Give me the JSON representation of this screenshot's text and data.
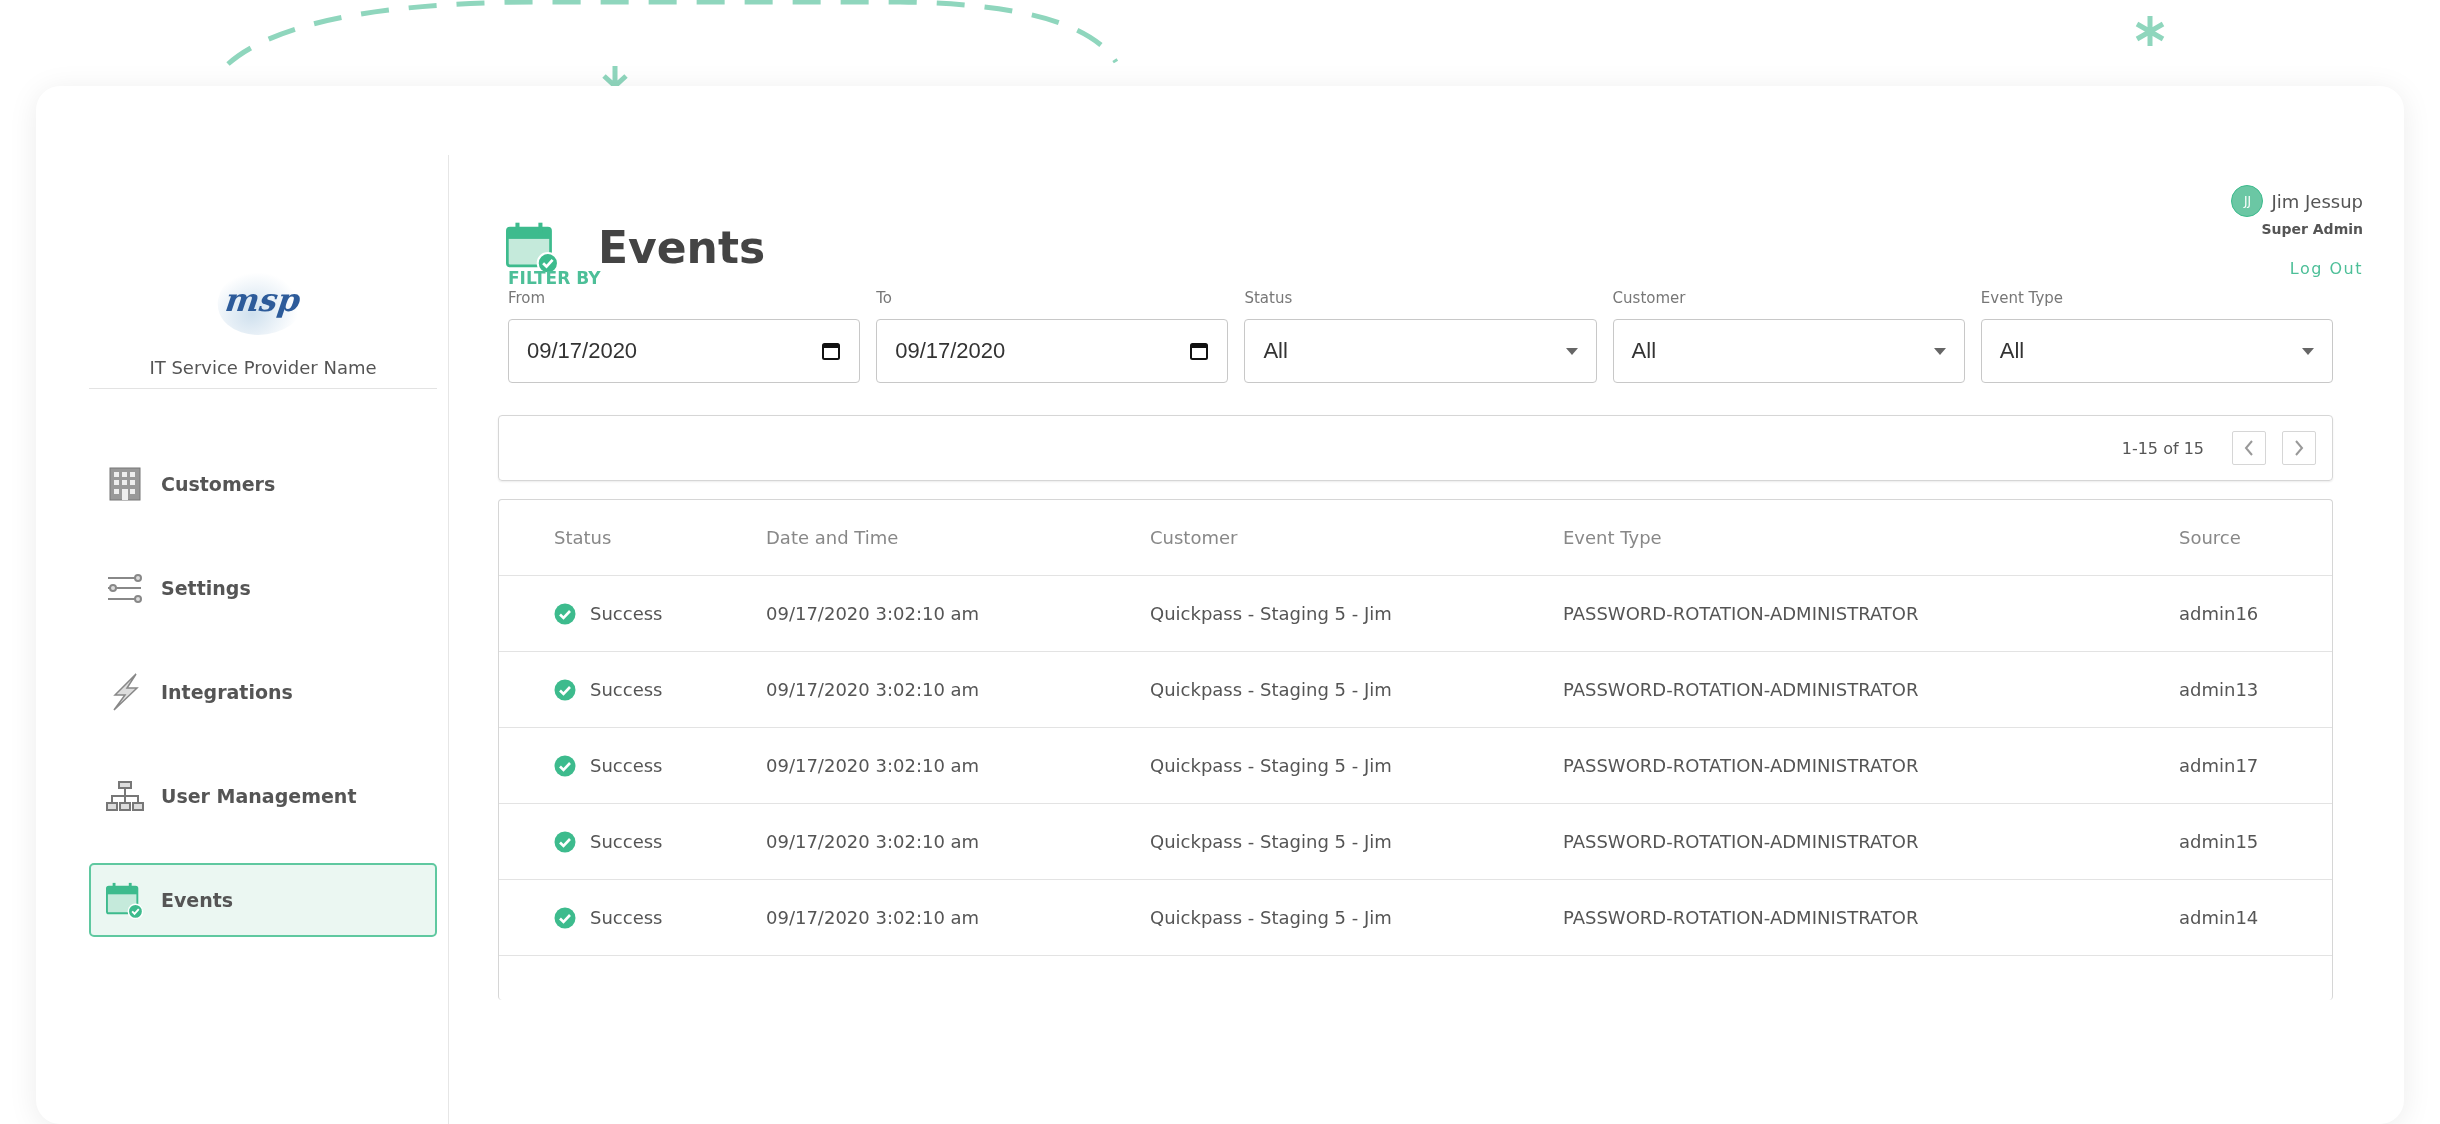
{
  "sidebar": {
    "logo_text": "msp",
    "provider_name": "IT Service Provider Name",
    "items": [
      {
        "label": "Customers",
        "kind": "building",
        "selected": false
      },
      {
        "label": "Settings",
        "kind": "sliders",
        "selected": false
      },
      {
        "label": "Integrations",
        "kind": "bolt",
        "selected": false
      },
      {
        "label": "User Management",
        "kind": "hierarchy",
        "selected": false
      },
      {
        "label": "Events",
        "kind": "calendar",
        "selected": true
      }
    ]
  },
  "page": {
    "title": "Events"
  },
  "user": {
    "initials": "JJ",
    "name": "Jim Jessup",
    "role": "Super Admin",
    "logout": "Log Out"
  },
  "filters": {
    "heading": "FILTER BY",
    "fields": [
      {
        "label": "From",
        "kind": "date",
        "value": "09/17/2020"
      },
      {
        "label": "To",
        "kind": "date",
        "value": "09/17/2020"
      },
      {
        "label": "Status",
        "kind": "select",
        "value": "All"
      },
      {
        "label": "Customer",
        "kind": "select",
        "value": "All"
      },
      {
        "label": "Event Type",
        "kind": "select",
        "value": "All"
      }
    ]
  },
  "pagination": {
    "range": "1-15 of 15"
  },
  "table": {
    "columns": [
      "Status",
      "Date and Time",
      "Customer",
      "Event Type",
      "Source"
    ],
    "rows": [
      {
        "status": "Success",
        "date_time": "09/17/2020 3:02:10 am",
        "customer": "Quickpass - Staging 5 - Jim",
        "event_type": "PASSWORD-ROTATION-ADMINISTRATOR",
        "source": "admin16"
      },
      {
        "status": "Success",
        "date_time": "09/17/2020 3:02:10 am",
        "customer": "Quickpass - Staging 5 - Jim",
        "event_type": "PASSWORD-ROTATION-ADMINISTRATOR",
        "source": "admin13"
      },
      {
        "status": "Success",
        "date_time": "09/17/2020 3:02:10 am",
        "customer": "Quickpass - Staging 5 - Jim",
        "event_type": "PASSWORD-ROTATION-ADMINISTRATOR",
        "source": "admin17"
      },
      {
        "status": "Success",
        "date_time": "09/17/2020 3:02:10 am",
        "customer": "Quickpass - Staging 5 - Jim",
        "event_type": "PASSWORD-ROTATION-ADMINISTRATOR",
        "source": "admin15"
      },
      {
        "status": "Success",
        "date_time": "09/17/2020 3:02:10 am",
        "customer": "Quickpass - Staging 5 - Jim",
        "event_type": "PASSWORD-ROTATION-ADMINISTRATOR",
        "source": "admin14"
      }
    ]
  }
}
